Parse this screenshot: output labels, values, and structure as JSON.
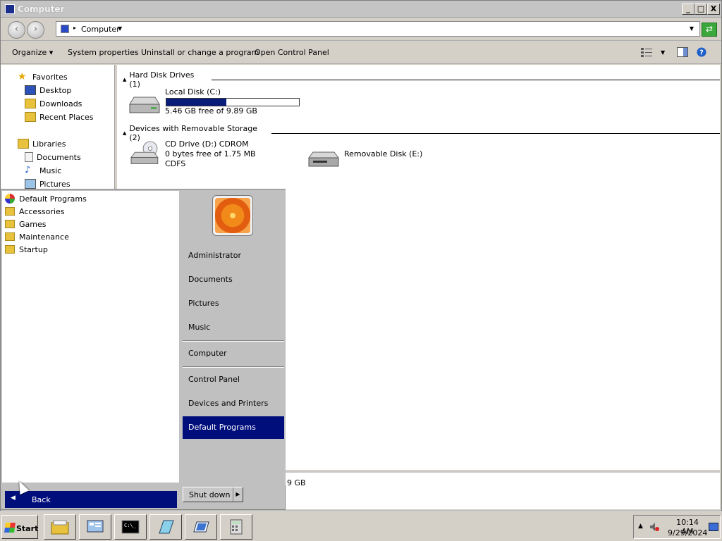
{
  "window": {
    "title": "Computer",
    "minimize_label": "_",
    "maximize_label": "□",
    "close_label": "X"
  },
  "address": {
    "crumb": "Computer"
  },
  "toolbar": {
    "organize": "Organize",
    "system_properties": "System properties",
    "uninstall": "Uninstall or change a program",
    "control_panel": "Open Control Panel"
  },
  "sidebar": {
    "favorites": "Favorites",
    "desktop": "Desktop",
    "downloads": "Downloads",
    "recent": "Recent Places",
    "libraries": "Libraries",
    "documents": "Documents",
    "music": "Music",
    "pictures": "Pictures"
  },
  "content": {
    "hdd_header": "Hard Disk Drives (1)",
    "removable_header": "Devices with Removable Storage (2)",
    "local_disk": {
      "name": "Local Disk (C:)",
      "free": "5.46 GB free of 9.89 GB",
      "used_fraction": 0.45
    },
    "cd_drive": {
      "name": "CD Drive (D:) CDROM",
      "free": "0 bytes free of 1.75 MB",
      "fs": "CDFS"
    },
    "removable": {
      "name": "Removable Disk (E:)"
    },
    "details_partial": "9 GB"
  },
  "startmenu": {
    "programs": [
      "Default Programs",
      "Accessories",
      "Games",
      "Maintenance",
      "Startup"
    ],
    "back": "Back",
    "right": {
      "user": "Administrator",
      "documents": "Documents",
      "pictures": "Pictures",
      "music": "Music",
      "computer": "Computer",
      "control_panel": "Control Panel",
      "devices": "Devices and Printers",
      "default_programs": "Default Programs"
    },
    "shutdown": "Shut down"
  },
  "taskbar": {
    "start": "Start",
    "time": "10:14 AM",
    "date": "9/29/2024"
  }
}
